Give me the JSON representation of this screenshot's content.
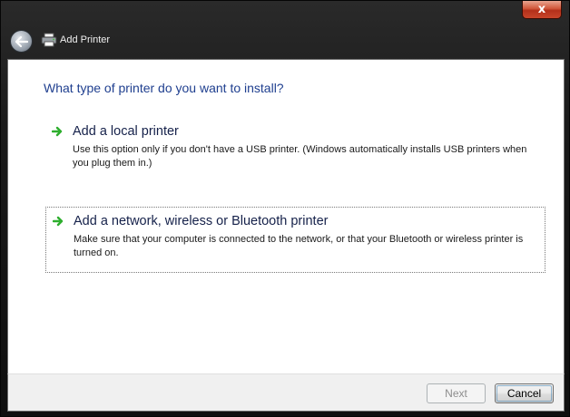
{
  "window": {
    "title": "Add Printer",
    "close_glyph": "x",
    "back_icon": "back-arrow-icon",
    "app_icon": "printer-icon"
  },
  "main": {
    "heading": "What type of printer do you want to install?",
    "options": [
      {
        "title": "Add a local printer",
        "description": "Use this option only if you don't have a USB printer. (Windows automatically installs USB printers when you plug them in.)",
        "icon": "green-arrow-icon"
      },
      {
        "title": "Add a network, wireless or Bluetooth printer",
        "description": "Make sure that your computer is connected to the network, or that your Bluetooth or wireless printer is turned on.",
        "icon": "green-arrow-icon"
      }
    ]
  },
  "footer": {
    "next_label": "Next",
    "cancel_label": "Cancel"
  },
  "colors": {
    "heading": "#1f3f8f",
    "arrow": "#2eae2e",
    "close": "#c9452a"
  }
}
